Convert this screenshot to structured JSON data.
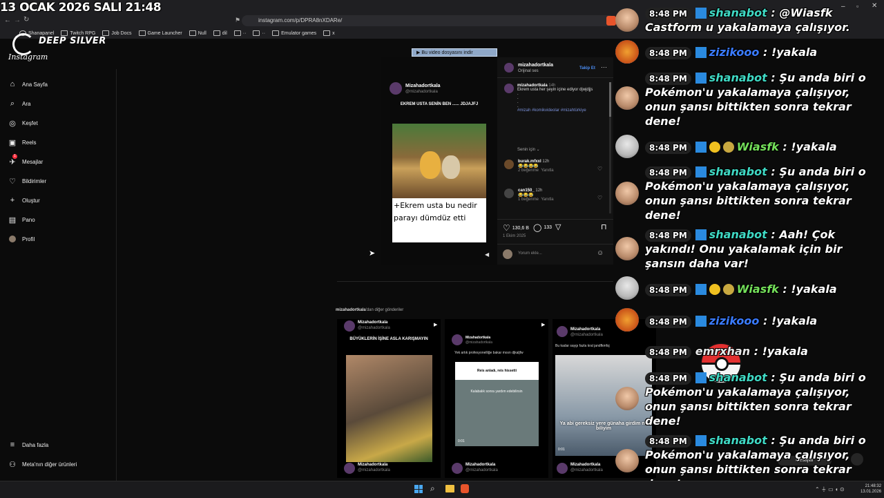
{
  "overlay": {
    "datetime": "13 OCAK 2026 SALI 21:48",
    "brand": "DEEP SILVER"
  },
  "browser": {
    "url": "instagram.com/p/DPRA8nXDARe/",
    "bookmarks": [
      "Shanapanel",
      "Twitch RPG",
      "Job Docs",
      "Game Launcher",
      "Null",
      "dil",
      "··",
      "··",
      "Emulator games",
      "x"
    ],
    "download_banner": "Bu video dosyasını indir"
  },
  "instagram": {
    "logo": "Instagram",
    "nav": [
      {
        "label": "Ana Sayfa",
        "icon": "home-icon"
      },
      {
        "label": "Ara",
        "icon": "search-icon"
      },
      {
        "label": "Keşfet",
        "icon": "compass-icon"
      },
      {
        "label": "Reels",
        "icon": "reels-icon"
      },
      {
        "label": "Mesajlar",
        "icon": "messages-icon",
        "badge": "1"
      },
      {
        "label": "Bildirimler",
        "icon": "heart-icon"
      },
      {
        "label": "Oluştur",
        "icon": "plus-icon"
      },
      {
        "label": "Pano",
        "icon": "dashboard-icon"
      },
      {
        "label": "Profil",
        "icon": "profile-icon"
      }
    ],
    "more": "Daha fazla",
    "meta": "Meta'nın diğer ürünleri",
    "post": {
      "video_user": "Mizahadortkala",
      "video_handle": "@mizahadortkala",
      "video_heading": "EKREM USTA SENİN BEN ...... JDJAJFJ",
      "video_caption": "+Ekrem usta bu nedir parayı dümdüz etti",
      "author": "mizahadortkala",
      "sound": "Orijinal ses",
      "follow": "Takip Et",
      "caption_time": "14h",
      "caption_text": "Ekrem usta her şeyin içine ediyor djwjdjjs",
      "hashtags": "#mizah #komikvideolar #mizahtürkiye",
      "for_you": "Senin için",
      "comments": [
        {
          "user": "burak.mfxxl",
          "time": "12h",
          "text": "😂😂😂😂",
          "likes": "2 beğenme",
          "reply": "Yanıtla"
        },
        {
          "user": "can150_",
          "time": "12h",
          "text": "😂😂😂",
          "likes": "1 beğenme",
          "reply": "Yanıtla"
        }
      ],
      "likes": "130,6 B",
      "comment_count": "133",
      "date": "1 Ekim 2025",
      "comment_placeholder": "Yorum ekle..."
    },
    "more_posts_title": "mizahadortkala",
    "more_posts_suffix": "'dan diğer gönderiler",
    "more_posts": [
      {
        "user": "Mizahadortkala",
        "handle": "@mizahadortkala",
        "text": "BÜYÜKLERİN İŞİNE ASLA KARIŞMAYIN"
      },
      {
        "user": "Mizahadortkala",
        "handle": "@mizahadortkala",
        "text": "Yek artık profesyonelliğe bakar mısın djkaljfw",
        "inner": "Reis anladı, reis hissetti",
        "inner2": "Kalabalık sonra yardım edebilirsin",
        "time": "0:01"
      },
      {
        "user": "Mizahadortkala",
        "handle": "@mizahadortkala",
        "text": "Bu kadar saygı fazla kral jandfkmfsj",
        "inner": "Ya abi gereksiz yere günaha girdim ne biliyim",
        "time": "0:01"
      }
    ],
    "messages_label": "Mesajlar"
  },
  "chat": [
    {
      "time": "8:48 PM",
      "user": "shanabot",
      "text": ": @Wiasfk Castform u yakalamaya çalışıyor."
    },
    {
      "time": "8:48 PM",
      "user": "zizikooo",
      "text": ": !yakala"
    },
    {
      "time": "8:48 PM",
      "user": "shanabot",
      "text": ": Şu anda biri o Pokémon'u yakalamaya çalışıyor, onun şansı bittikten sonra tekrar dene!"
    },
    {
      "time": "8:48 PM",
      "user": "Wiasfk",
      "text": ": !yakala"
    },
    {
      "time": "8:48 PM",
      "user": "shanabot",
      "text": ": Şu anda biri o Pokémon'u yakalamaya çalışıyor, onun şansı bittikten sonra tekrar dene!"
    },
    {
      "time": "8:48 PM",
      "user": "shanabot",
      "text": ": Aah! Çok yakındı! Onu yakalamak için bir şansın daha var!"
    },
    {
      "time": "8:48 PM",
      "user": "Wiasfk",
      "text": ": !yakala"
    },
    {
      "time": "8:48 PM",
      "user": "zizikooo",
      "text": ": !yakala"
    },
    {
      "time": "8:48 PM",
      "user": "emrxhan",
      "text": ": !yakala"
    },
    {
      "time": "8:48 PM",
      "user": "shanabot",
      "text": ": Şu anda biri o Pokémon'u yakalamaya çalışıyor, onun şansı bittikten sonra tekrar dene!"
    },
    {
      "time": "8:48 PM",
      "user": "shanabot",
      "text": ": Şu anda biri o Pokémon'u yakalamaya çalışıyor, onun şansı bittikten sonra tekrar dene!"
    }
  ],
  "taskbar": {
    "time": "21:48:32",
    "date": "13.01.2026"
  },
  "colors": {
    "shanabot": "#3fd9c4",
    "zizikooo": "#3a7bff",
    "wiasfk": "#74e05a",
    "instagram_blue": "#4b8ef5"
  }
}
